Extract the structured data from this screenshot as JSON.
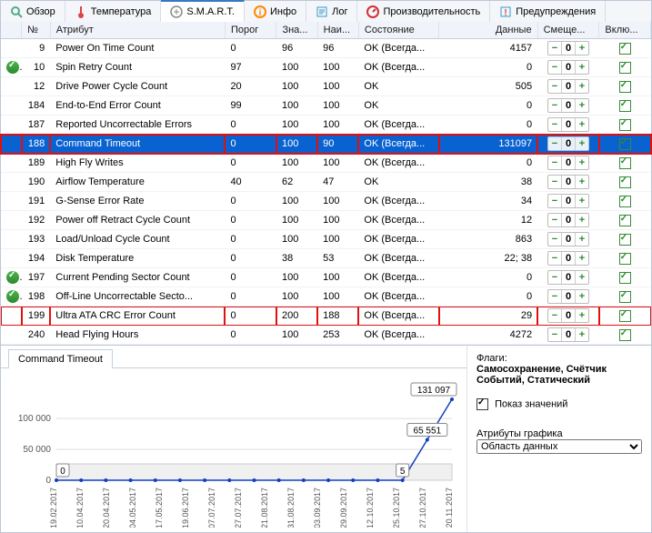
{
  "tabs": [
    {
      "key": "overview",
      "label": "Обзор",
      "icon": "magnifier-icon"
    },
    {
      "key": "temperature",
      "label": "Температура",
      "icon": "thermometer-icon"
    },
    {
      "key": "smart",
      "label": "S.M.A.R.T.",
      "icon": "diag-icon",
      "active": true
    },
    {
      "key": "info",
      "label": "Инфо",
      "icon": "info-icon"
    },
    {
      "key": "log",
      "label": "Лог",
      "icon": "log-icon"
    },
    {
      "key": "perf",
      "label": "Производительность",
      "icon": "gauge-icon"
    },
    {
      "key": "warn",
      "label": "Предупреждения",
      "icon": "warn-icon"
    }
  ],
  "columns": {
    "num": "№",
    "attr": "Атрибут",
    "threshold": "Порог",
    "value": "Зна...",
    "worst": "Наи...",
    "state": "Состояние",
    "data": "Данные",
    "offset": "Смеще...",
    "incl": "Вклю..."
  },
  "rows": [
    {
      "n": 9,
      "attr": "Power On Time Count",
      "thr": 0,
      "val": 96,
      "wst": 96,
      "state": "OK (Всегда...",
      "data": "4157",
      "incl": true
    },
    {
      "n": 10,
      "attr": "Spin Retry Count",
      "thr": 97,
      "val": 100,
      "wst": 100,
      "state": "OK (Всегда...",
      "data": "0",
      "incl": true,
      "mark": "ok"
    },
    {
      "n": 12,
      "attr": "Drive Power Cycle Count",
      "thr": 20,
      "val": 100,
      "wst": 100,
      "state": "OK",
      "data": "505",
      "incl": true
    },
    {
      "n": 184,
      "attr": "End-to-End Error Count",
      "thr": 99,
      "val": 100,
      "wst": 100,
      "state": "OK",
      "data": "0",
      "incl": true
    },
    {
      "n": 187,
      "attr": "Reported Uncorrectable Errors",
      "thr": 0,
      "val": 100,
      "wst": 100,
      "state": "OK (Всегда...",
      "data": "0",
      "incl": true
    },
    {
      "n": 188,
      "attr": "Command Timeout",
      "thr": 0,
      "val": 100,
      "wst": 90,
      "state": "OK (Всегда...",
      "data": "131097",
      "incl": true,
      "sel": true,
      "red": true
    },
    {
      "n": 189,
      "attr": "High Fly Writes",
      "thr": 0,
      "val": 100,
      "wst": 100,
      "state": "OK (Всегда...",
      "data": "0",
      "incl": true
    },
    {
      "n": 190,
      "attr": "Airflow Temperature",
      "thr": 40,
      "val": 62,
      "wst": 47,
      "state": "OK",
      "data": "38",
      "incl": true
    },
    {
      "n": 191,
      "attr": "G-Sense Error Rate",
      "thr": 0,
      "val": 100,
      "wst": 100,
      "state": "OK (Всегда...",
      "data": "34",
      "incl": true
    },
    {
      "n": 192,
      "attr": "Power off Retract Cycle Count",
      "thr": 0,
      "val": 100,
      "wst": 100,
      "state": "OK (Всегда...",
      "data": "12",
      "incl": true
    },
    {
      "n": 193,
      "attr": "Load/Unload Cycle Count",
      "thr": 0,
      "val": 100,
      "wst": 100,
      "state": "OK (Всегда...",
      "data": "863",
      "incl": true
    },
    {
      "n": 194,
      "attr": "Disk Temperature",
      "thr": 0,
      "val": 38,
      "wst": 53,
      "state": "OK (Всегда...",
      "data": "22; 38",
      "incl": true
    },
    {
      "n": 197,
      "attr": "Current Pending Sector Count",
      "thr": 0,
      "val": 100,
      "wst": 100,
      "state": "OK (Всегда...",
      "data": "0",
      "incl": true,
      "mark": "ok"
    },
    {
      "n": 198,
      "attr": "Off-Line Uncorrectable Secto...",
      "thr": 0,
      "val": 100,
      "wst": 100,
      "state": "OK (Всегда...",
      "data": "0",
      "incl": true,
      "mark": "ok"
    },
    {
      "n": 199,
      "attr": "Ultra ATA CRC Error Count",
      "thr": 0,
      "val": 200,
      "wst": 188,
      "state": "OK (Всегда...",
      "data": "29",
      "incl": true,
      "red": true
    },
    {
      "n": 240,
      "attr": "Head Flying Hours",
      "thr": 0,
      "val": 100,
      "wst": 253,
      "state": "OK (Всегда...",
      "data": "4272",
      "incl": true
    }
  ],
  "detail": {
    "tab_label": "Command Timeout",
    "flags_label": "Флаги:",
    "flags_value": "Самосохранение, Счётчик Событий, Статический",
    "show_values": "Показ значений",
    "chart_attr_label": "Атрибуты графика",
    "chart_attr_value": "Область данных"
  },
  "chart_data": {
    "type": "line",
    "title": "",
    "xlabel": "",
    "ylabel": "",
    "categories": [
      "19.02.2017",
      "10.04.2017",
      "20.04.2017",
      "04.05.2017",
      "17.05.2017",
      "19.06.2017",
      "07.07.2017",
      "27.07.2017",
      "21.08.2017",
      "31.08.2017",
      "03.09.2017",
      "29.09.2017",
      "12.10.2017",
      "25.10.2017",
      "27.10.2017",
      "20.11.2017"
    ],
    "values": [
      0,
      0,
      0,
      0,
      0,
      0,
      0,
      0,
      0,
      0,
      0,
      0,
      0,
      0,
      5,
      65551,
      131097
    ],
    "ylim": [
      0,
      140000
    ],
    "yticks": [
      0,
      50000,
      100000
    ],
    "callouts": [
      {
        "idx": 0,
        "label": "0"
      },
      {
        "idx": 14,
        "label": "5"
      },
      {
        "idx": 15,
        "label": "65 551"
      },
      {
        "idx": 16,
        "label": "131 097"
      }
    ]
  }
}
